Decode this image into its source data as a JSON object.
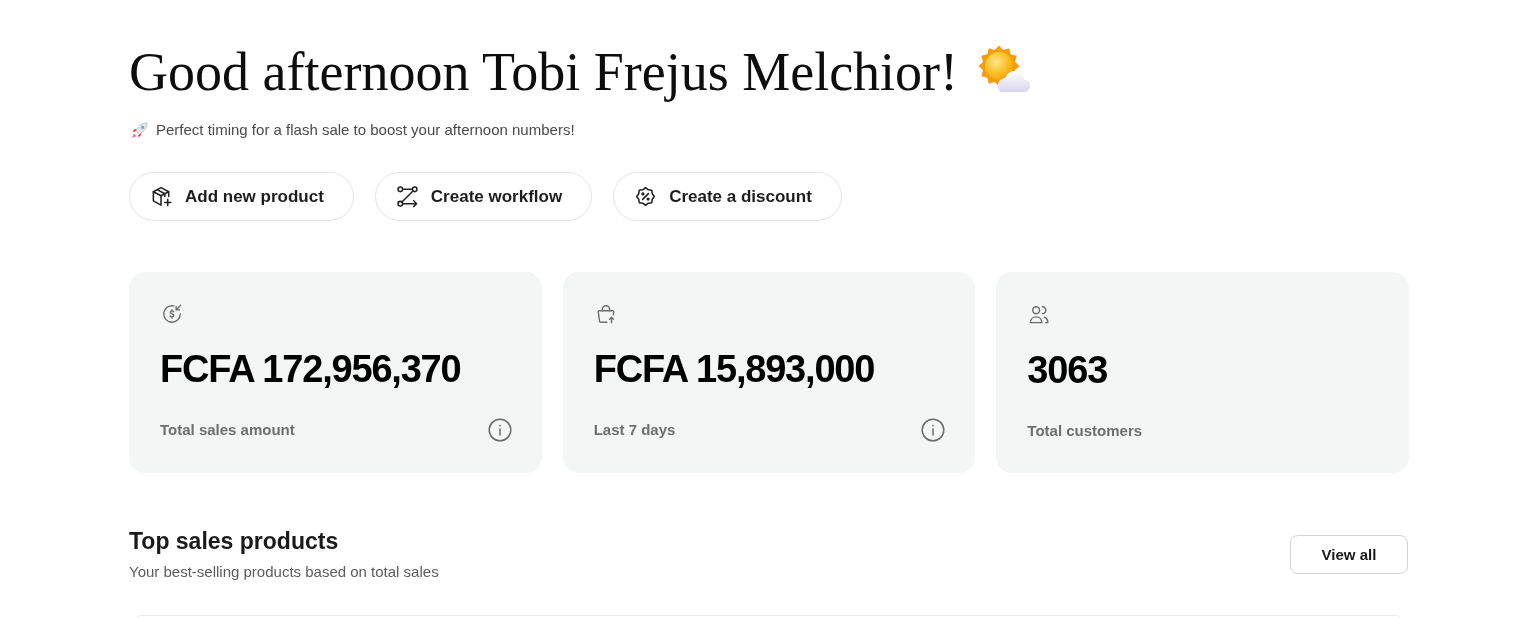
{
  "greeting": {
    "title": "Good afternoon Tobi Frejus Melchior!",
    "tip": "Perfect timing for a flash sale to boost your afternoon numbers!"
  },
  "actions": [
    {
      "kind": "product",
      "label": "Add new product"
    },
    {
      "kind": "workflow",
      "label": "Create workflow"
    },
    {
      "kind": "discount",
      "label": "Create a discount"
    }
  ],
  "stats": [
    {
      "kind": "sales",
      "value": "FCFA 172,956,370",
      "label": "Total sales amount",
      "info": true
    },
    {
      "kind": "orders",
      "value": "FCFA 15,893,000",
      "label": "Last 7 days",
      "info": true
    },
    {
      "kind": "customers",
      "value": "3063",
      "label": "Total customers",
      "info": false
    }
  ],
  "top_products": {
    "title": "Top sales products",
    "subtitle": "Your best-selling products based on total sales",
    "button": "View all"
  }
}
